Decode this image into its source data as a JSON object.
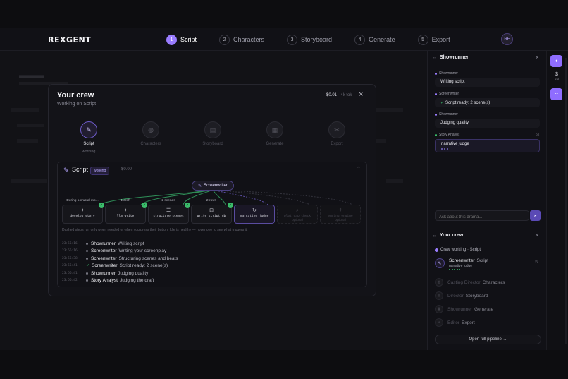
{
  "app": {
    "logo": "REXGENT",
    "avatar": "RE"
  },
  "steps": [
    {
      "num": "1",
      "label": "Script",
      "active": true
    },
    {
      "num": "2",
      "label": "Characters"
    },
    {
      "num": "3",
      "label": "Storyboard"
    },
    {
      "num": "4",
      "label": "Generate"
    },
    {
      "num": "5",
      "label": "Export"
    }
  ],
  "modal": {
    "title": "Your crew",
    "subtitle": "Working on Script",
    "cost": "$0.01",
    "tokens": "· 4k tok",
    "close_icon": "×",
    "agents": [
      {
        "name": "Script",
        "status": "working",
        "icon": "✎"
      },
      {
        "name": "Characters",
        "icon": "◍"
      },
      {
        "name": "Storyboard",
        "icon": "▤"
      },
      {
        "name": "Generate",
        "icon": "▦"
      },
      {
        "name": "Export",
        "icon": "✂"
      }
    ],
    "panel": {
      "title": "Script",
      "badge": "working",
      "cost": "$0.00",
      "chevron": "⌃",
      "agent_pill": "Screenwriter",
      "tools": [
        {
          "label": "During a crucial mo...",
          "name": "develop_story",
          "icon": "✦",
          "done": true
        },
        {
          "label": "1 draft",
          "name": "llm_write",
          "icon": "✦",
          "done": true
        },
        {
          "label": "2 scenes",
          "name": "structure_scenes",
          "icon": "☰",
          "done": true
        },
        {
          "label": "2 rows",
          "name": "write_script_db",
          "icon": "⊟",
          "done": true
        },
        {
          "label": "",
          "name": "narrative_judge",
          "icon": "↻",
          "running": true
        },
        {
          "label": "",
          "name": "plot_gap_check",
          "icon": "⌕",
          "optional": "optional"
        },
        {
          "label": "",
          "name": "ending_engine",
          "icon": "⚘",
          "optional": "optional"
        }
      ],
      "note": "Dashed steps run only when needed or when you press their button. Idle is healthy — hover one to see what triggers it.",
      "log": [
        {
          "time": "23:56:16",
          "who": "Showrunner",
          "msg": "Writing script",
          "ok": false
        },
        {
          "time": "23:56:16",
          "who": "Screenwriter",
          "msg": "Writing your screenplay",
          "ok": false
        },
        {
          "time": "23:56:38",
          "who": "Screenwriter",
          "msg": "Structuring scenes and beats",
          "ok": false
        },
        {
          "time": "23:56:41",
          "who": "Screenwriter",
          "msg": "Script ready: 2 scene(s)",
          "ok": true
        },
        {
          "time": "23:56:41",
          "who": "Showrunner",
          "msg": "Judging quality",
          "ok": false
        },
        {
          "time": "23:56:42",
          "who": "Story Analyst",
          "msg": "Judging the draft",
          "ok": false
        }
      ]
    }
  },
  "sidebar": {
    "title": "Showrunner",
    "close_icon": "×",
    "messages": [
      {
        "who": "Showrunner",
        "text": "Writing script"
      },
      {
        "who": "Screenwriter",
        "text": "Script ready: 2 scene(s)",
        "ok": true
      },
      {
        "who": "Showrunner",
        "text": "Judging quality"
      },
      {
        "who": "Story Analyst",
        "text": "narrative judge",
        "time": "5s"
      }
    ],
    "ask_placeholder": "Ask about this drama...",
    "send_icon": "➤",
    "crew": {
      "title": "Your crew",
      "close_icon": "×",
      "working": "Crew working · Script",
      "active": {
        "role": "Screenwriter",
        "step": "Script",
        "sub": "narrative judge"
      },
      "others": [
        {
          "role": "Casting Director",
          "step": "Characters",
          "icon": "◍"
        },
        {
          "role": "Director",
          "step": "Storyboard",
          "icon": "▤"
        },
        {
          "role": "Showrunner",
          "step": "Generate",
          "icon": "▦"
        },
        {
          "role": "Editor",
          "step": "Export",
          "icon": "✂"
        }
      ],
      "open_pipeline": "Open full pipeline →"
    }
  },
  "strip": {
    "cost_symbol": "$",
    "cost_value": "0.0"
  },
  "colors": {
    "accent": "#9a7dff",
    "success": "#3bbd6b"
  }
}
